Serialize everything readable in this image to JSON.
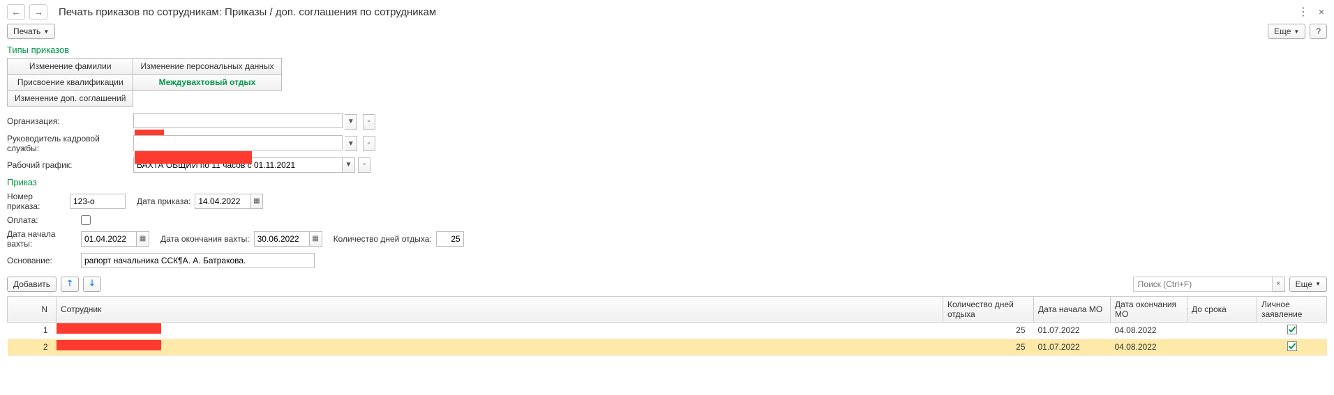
{
  "header": {
    "title": "Печать приказов по сотрудникам: Приказы / доп. соглашения по сотрудникам"
  },
  "toolbar": {
    "print_label": "Печать",
    "more_label": "Еще",
    "help_label": "?"
  },
  "sections": {
    "types_title": "Типы приказов",
    "order_title": "Приказ"
  },
  "types": {
    "r1c1": "Изменение фамилии",
    "r1c2": "Изменение персональных данных",
    "r2c1": "Присвоение квалификации",
    "r2c2": "Междувахтовый отдых",
    "r3c1": "Изменение доп. соглашений"
  },
  "labels": {
    "organization": "Организация:",
    "hr_head": "Руководитель кадровой службы:",
    "schedule": "Рабочий график:",
    "order_no": "Номер приказа:",
    "order_date": "Дата приказа:",
    "payment": "Оплата:",
    "shift_start": "Дата начала вахты:",
    "shift_end": "Дата окончания вахты:",
    "rest_days": "Количество дней отдыха:",
    "reason": "Основание:",
    "add": "Добавить"
  },
  "values": {
    "organization": "",
    "hr_head": "",
    "schedule": "ВАХТА ОБЩИЙ по 11 часов с 01.11.2021",
    "order_no": "123-о",
    "order_date": "14.04.2022",
    "shift_start": "01.04.2022",
    "shift_end": "30.06.2022",
    "rest_days": "25",
    "reason": "рапорт начальника ССК¶А. А. Батракова."
  },
  "search": {
    "placeholder": "Поиск (Ctrl+F)"
  },
  "table": {
    "cols": {
      "n": "N",
      "employee": "Сотрудник",
      "days": "Количество дней отдыха",
      "start": "Дата начала МО",
      "end": "Дата окончания МО",
      "deadline": "До срока",
      "personal": "Личное заявление"
    },
    "rows": [
      {
        "n": "1",
        "employee": "А",
        "days": "25",
        "start": "01.07.2022",
        "end": "04.08.2022",
        "deadline": "",
        "personal": true
      },
      {
        "n": "2",
        "employee": "А",
        "days": "25",
        "start": "01.07.2022",
        "end": "04.08.2022",
        "deadline": "",
        "personal": true
      }
    ]
  }
}
